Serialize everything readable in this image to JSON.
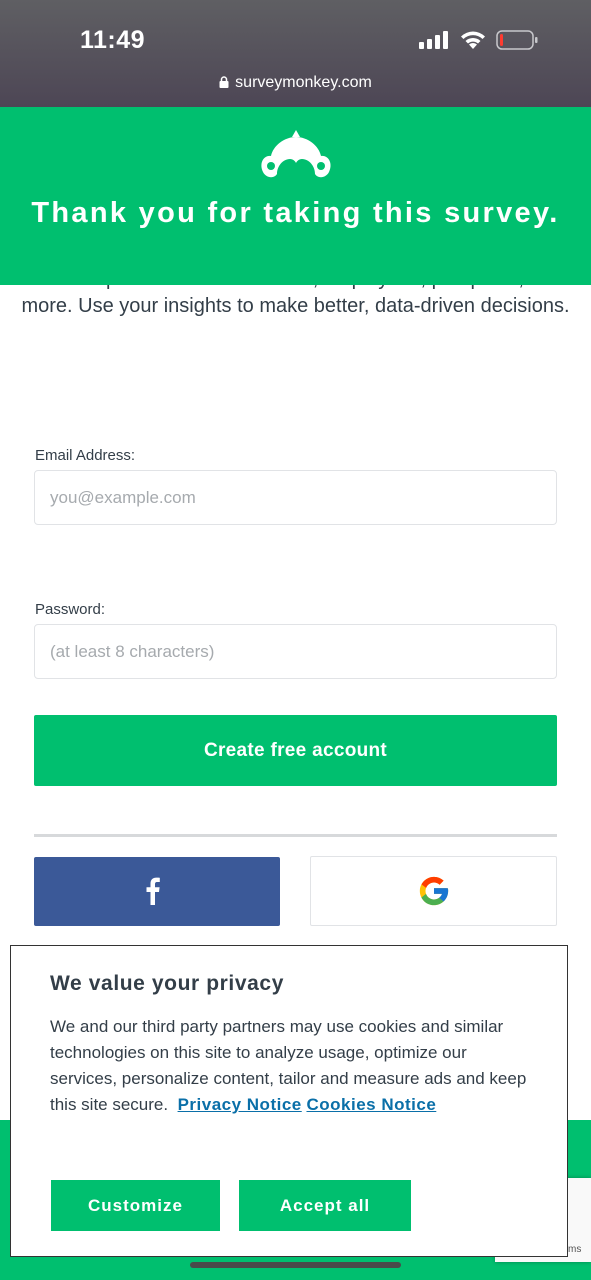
{
  "status_bar": {
    "time": "11:49",
    "url": "surveymonkey.com",
    "icons": [
      "signal-icon",
      "wifi-icon",
      "battery-icon",
      "lock-icon"
    ]
  },
  "header": {
    "title": "Thank you for taking this survey.",
    "logo": "surveymonkey-logo-icon",
    "background": "#00bf6f"
  },
  "intro": {
    "text": "Gather opinions from customers, employees, prospects, and more. Use your insights to make better, data-driven decisions."
  },
  "signup_form": {
    "email_label": "Email Address:",
    "email_placeholder": "you@example.com",
    "email_value": "",
    "password_label": "Password:",
    "password_placeholder": "(at least 8 characters)",
    "password_value": "",
    "submit_label": "Create free account",
    "facebook_icon": "facebook-icon",
    "google_icon": "google-icon",
    "facebook_color": "#3b5998"
  },
  "privacy_modal": {
    "title": "We value your privacy",
    "body": "We and our third party partners may use cookies and similar technologies on this site to analyze usage, optimize our services, personalize content, tailor and measure ads and keep this site secure.",
    "privacy_link": "Privacy Notice",
    "cookies_link": "Cookies Notice",
    "customize_label": "Customize",
    "accept_label": "Accept all",
    "link_color": "#0a6fa8"
  },
  "footer": {
    "recaptcha_text": "ms"
  },
  "colors": {
    "accent": "#00bf6f",
    "text": "#333e48"
  }
}
